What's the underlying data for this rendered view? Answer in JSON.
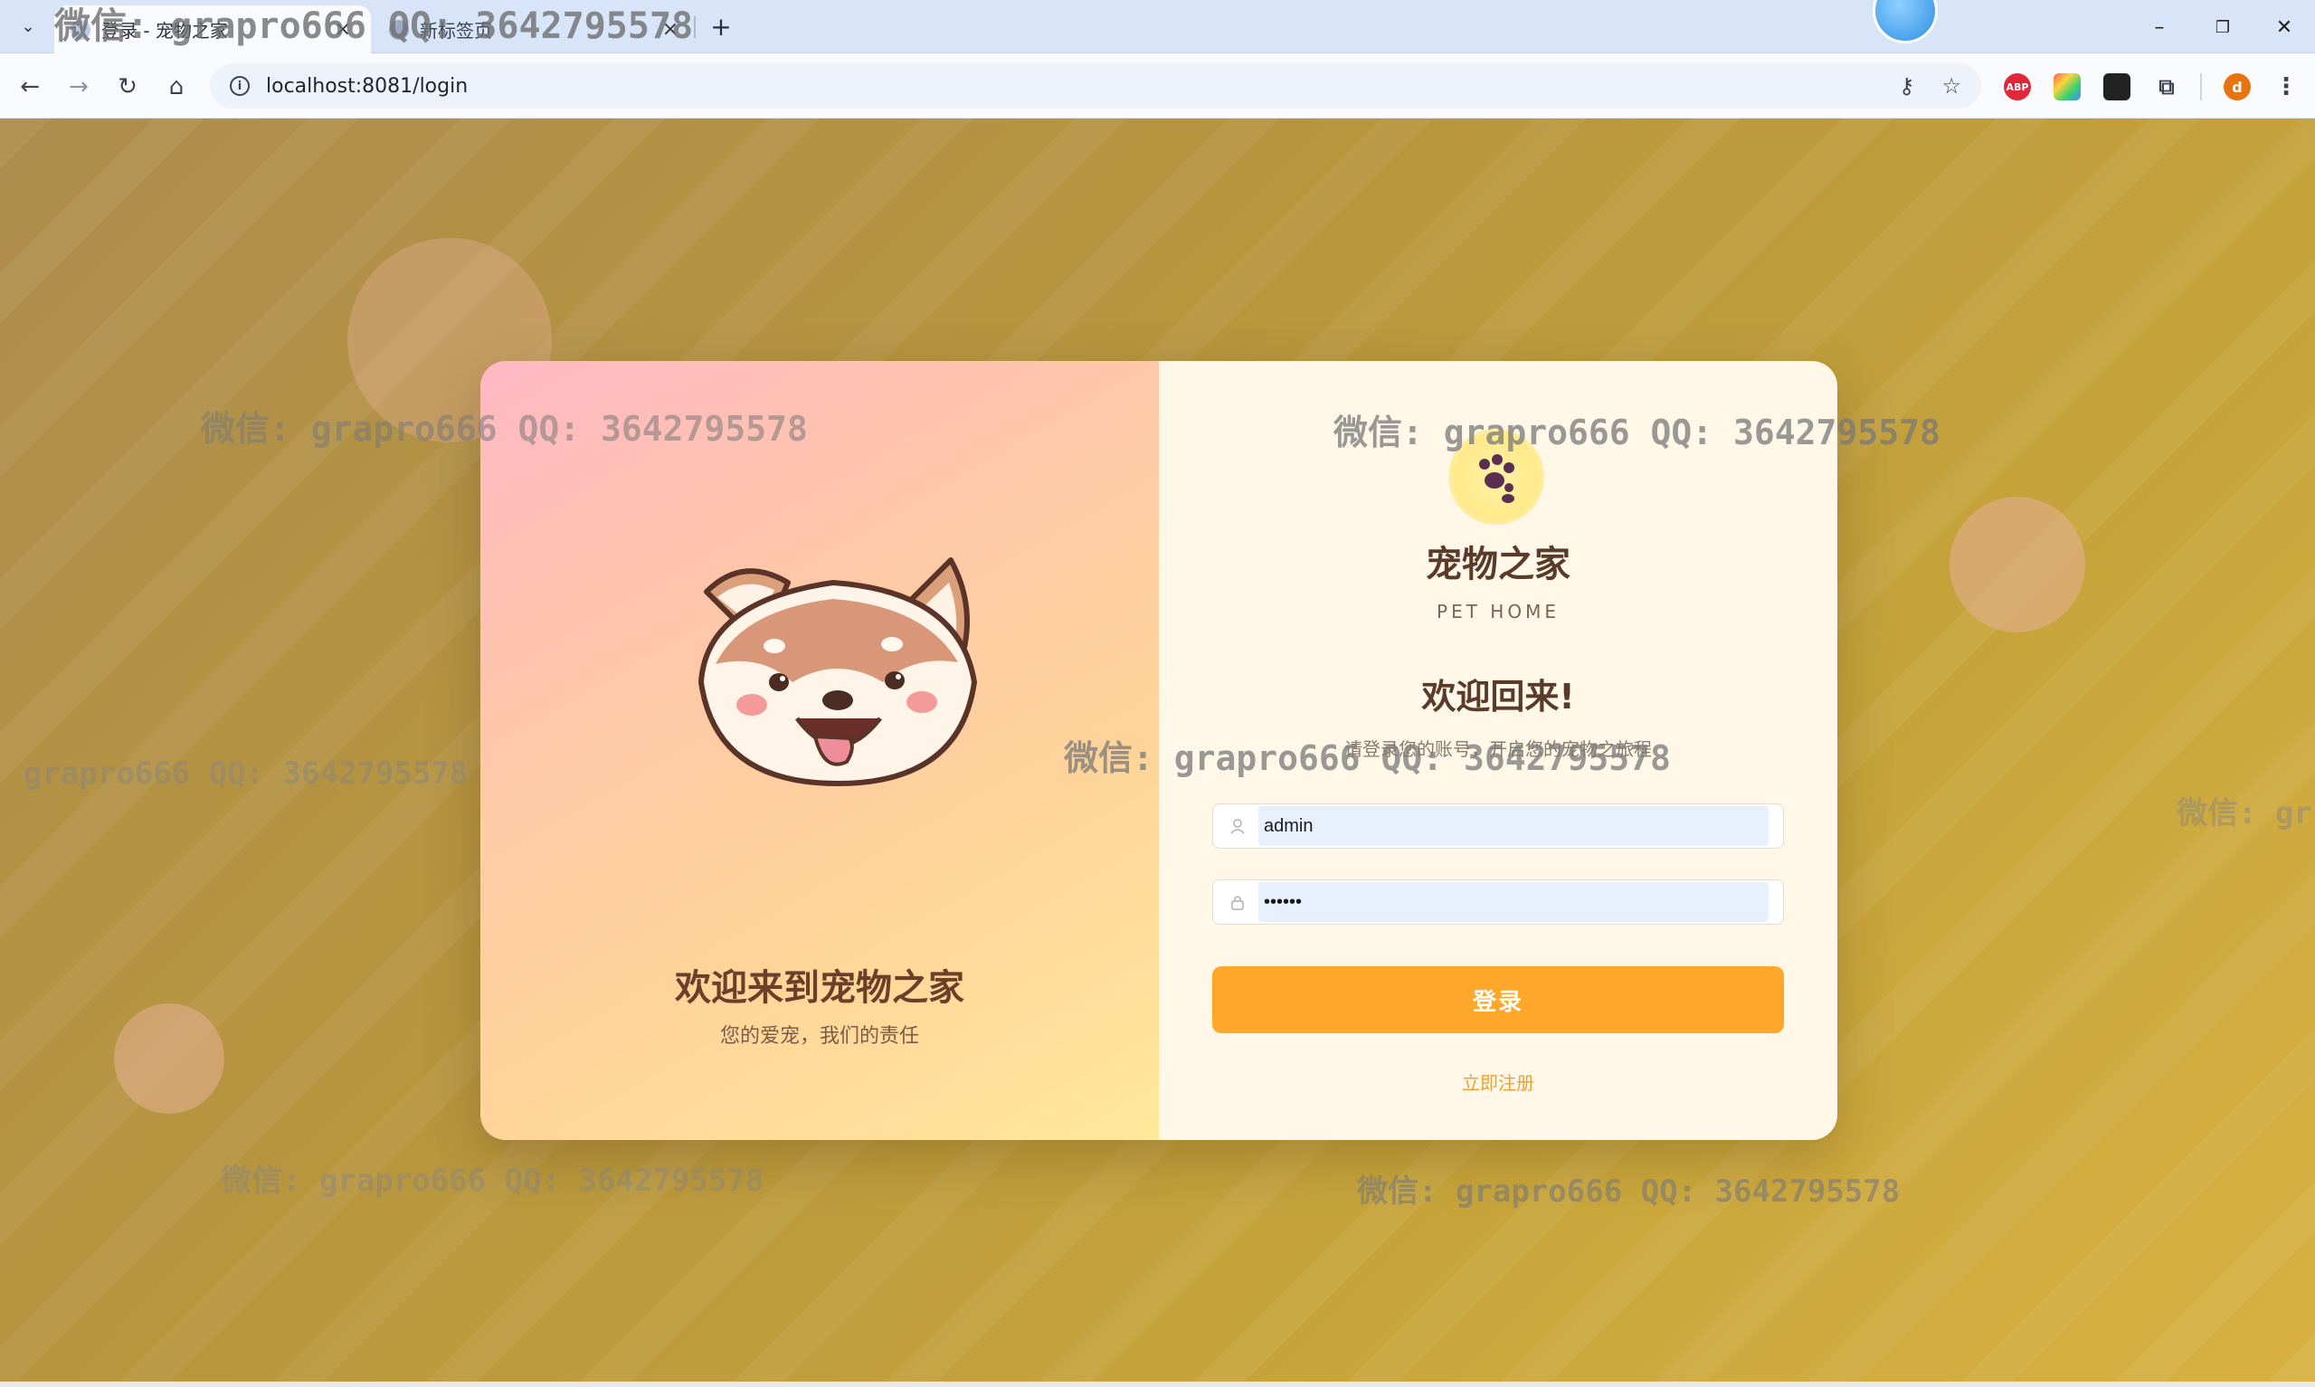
{
  "browser": {
    "tabs": [
      {
        "title": "登录 - 宠物之家",
        "close": "×"
      },
      {
        "title": "新标签页",
        "close": "×"
      }
    ],
    "new_tab": "+",
    "url": "localhost:8081/login",
    "window_controls": {
      "minimize": "–",
      "restore": "❐",
      "close": "✕"
    },
    "profile_initial": "d",
    "ext_abp": "ABP"
  },
  "left_panel": {
    "title": "欢迎来到宠物之家",
    "subtitle": "您的爱宠，我们的责任"
  },
  "right_panel": {
    "app_name": "宠物之家",
    "app_name_en": "PET HOME",
    "welcome": "欢迎回来!",
    "welcome_sub": "请登录您的账号，开启您的宠物之旅程",
    "username_value": "admin",
    "password_value": "••••••",
    "login_button": "登录",
    "register_link": "立即注册"
  },
  "watermark": {
    "text": "微信: grapro666 QQ: 3642795578",
    "partial_left": "grapro666 QQ: 3642795578",
    "partial_right": "微信: gr"
  },
  "colors": {
    "accent": "#ffa72a",
    "title_brown": "#5a3a28",
    "card_right_bg": "#fff8e9"
  }
}
